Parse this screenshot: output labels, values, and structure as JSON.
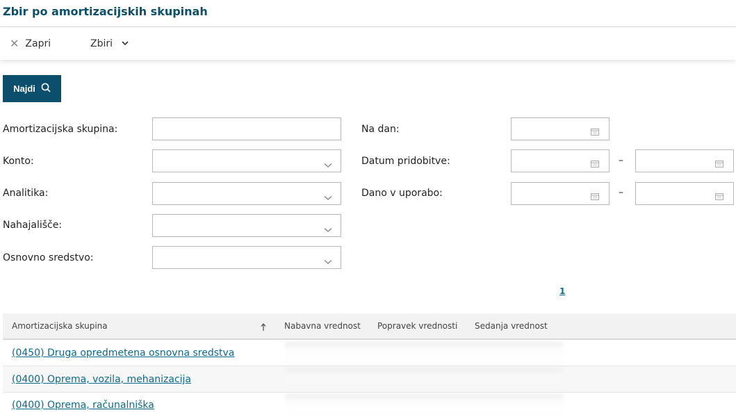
{
  "page": {
    "title": "Zbir po amortizacijskih skupinah"
  },
  "toolbar": {
    "close_label": "Zapri",
    "zbiri_label": "Zbiri"
  },
  "search": {
    "button_label": "Najdi"
  },
  "filters": {
    "amortizacijska_skupina": {
      "label": "Amortizacijska skupina:",
      "value": ""
    },
    "konto": {
      "label": "Konto:",
      "value": ""
    },
    "analitika": {
      "label": "Analitika:",
      "value": ""
    },
    "nahajalisce": {
      "label": "Nahajališče:",
      "value": ""
    },
    "osnovno_sredstvo": {
      "label": "Osnovno sredstvo:",
      "value": ""
    },
    "na_dan": {
      "label": "Na dan:",
      "value": ""
    },
    "datum_pridobitve": {
      "label": "Datum pridobitve:",
      "separator": "–"
    },
    "dano_v_uporabo": {
      "label": "Dano v uporabo:",
      "separator": "–"
    }
  },
  "pagination": {
    "current_page": "1"
  },
  "table": {
    "columns": [
      "Amortizacijska skupina",
      "Nabavna vrednost",
      "Popravek vrednosti",
      "Sedanja vrednost"
    ],
    "sort": "ascending",
    "rows": [
      {
        "skupina": "(0450) Druga opredmetena osnovna sredstva"
      },
      {
        "skupina": "(0400) Oprema, vozila, mehanizacija"
      },
      {
        "skupina": "(0400) Oprema, računalniška"
      }
    ]
  },
  "icons": {
    "close": "close-icon",
    "chevron": "chevron-down-icon",
    "search": "search-icon",
    "dropdown": "chevron-down-icon",
    "calendar": "calendar-icon",
    "sort": "sort-ascending-icon"
  },
  "colors": {
    "brand": "#0b4f6c",
    "link": "#0b6a8d"
  }
}
